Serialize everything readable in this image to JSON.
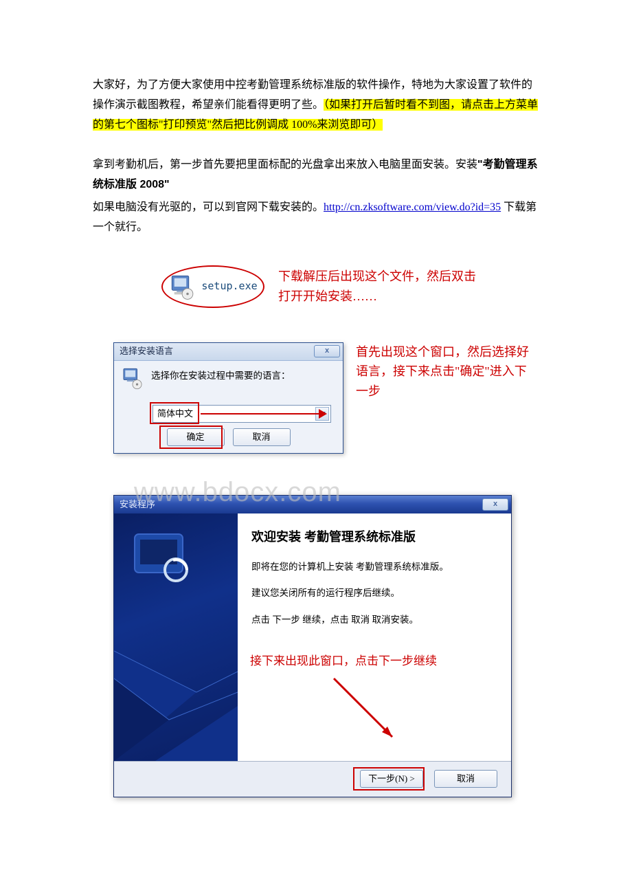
{
  "intro": {
    "p1a": "大家好，为了方便大家使用中控考勤管理系统标准版的软件操作，特地为大家设置了软件的操作演示截图教程，希望亲们能看得更明了些。",
    "p1b": "（如果打开后暂时看不到图，请点击上方菜单的第七个图标\"打印预览\"然后把比例调成 100%来浏览即可）"
  },
  "step1": {
    "p2a": "拿到考勤机后，第一步首先要把里面标配的光盘拿出来放入电脑里面安装。安装",
    "p2b": "\"考勤管理系统标准版 2008\"",
    "p3a": "如果电脑没有光驱的，可以到官网下载安装的。",
    "link_text": "http://cn.zksoftware.com/view.do?id=35",
    "p3b": " 下载第一个就行。"
  },
  "setup": {
    "filename": "setup.exe",
    "note": "下载解压后出现这个文件，然后双击打开开始安装……"
  },
  "lang_dialog": {
    "title": "选择安装语言",
    "close_x": "x",
    "prompt": "选择你在安装过程中需要的语言：",
    "selected": "简体中文",
    "ok": "确定",
    "cancel": "取消",
    "note": "首先出现这个窗口，然后选择好语言，接下来点击\"确定\"进入下一步"
  },
  "watermark": "www.bdocx.com",
  "wizard": {
    "title": "安装程序",
    "close_x": "x",
    "heading": "欢迎安装 考勤管理系统标准版",
    "line1": "即将在您的计算机上安装 考勤管理系统标准版。",
    "line2": "建议您关闭所有的运行程序后继续。",
    "line3": "点击 下一步 继续，点击 取消 取消安装。",
    "note": "接下来出现此窗口，点击下一步继续",
    "next": "下一步(N) >",
    "cancel": "取消"
  }
}
